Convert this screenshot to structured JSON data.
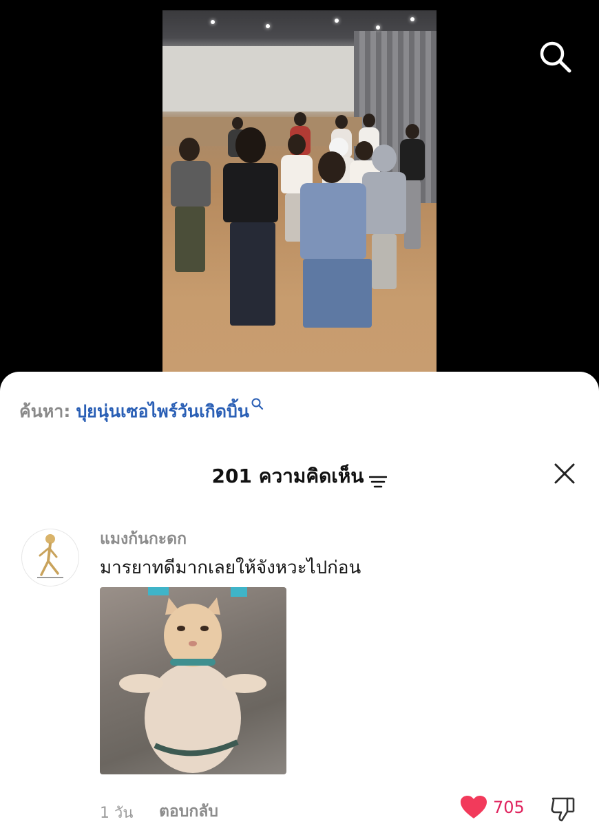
{
  "search_bar": {
    "prefix": "ค้นหา:",
    "term": "ปุยนุ่นเซอไพร์วันเกิดบิ้น"
  },
  "comments_header": {
    "title": "201 ความคิดเห็น"
  },
  "comment": {
    "username": "แมงก้นกะดก",
    "text": "มารยาทดีมากเลยให้จังหวะไปก่อน",
    "time": "1 วัน",
    "reply_label": "ตอบกลับ",
    "like_count": "705",
    "media_icon": "dancing-cat-image"
  },
  "icons": {
    "top_search": "search-icon",
    "sort": "sort-icon",
    "close": "close-icon",
    "heart": "heart-icon",
    "dislike": "thumbs-down-icon"
  },
  "colors": {
    "search_term": "#2a5fb5",
    "like": "#e0245e"
  }
}
